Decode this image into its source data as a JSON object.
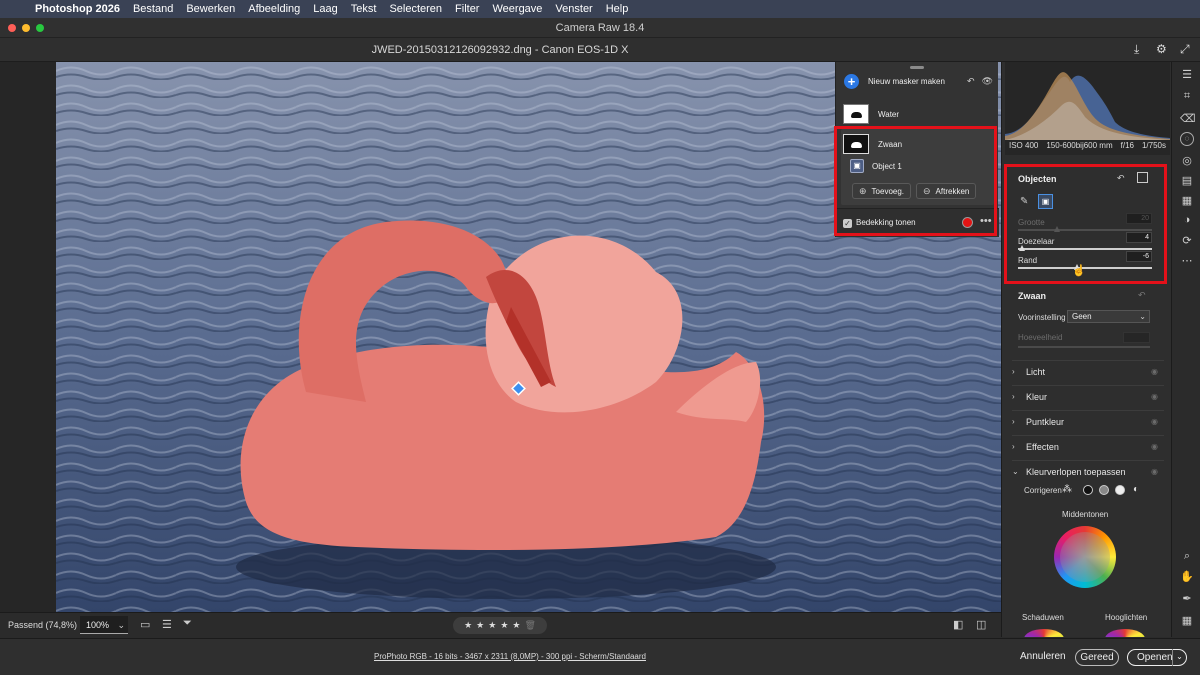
{
  "menubar": {
    "app": "Photoshop 2026",
    "items": [
      "Bestand",
      "Bewerken",
      "Afbeelding",
      "Laag",
      "Tekst",
      "Selecteren",
      "Filter",
      "Weergave",
      "Venster",
      "Help"
    ]
  },
  "window": {
    "title": "Camera Raw 18.4"
  },
  "file": {
    "name": "JWED-20150312126092932.dng",
    "separator": "-",
    "camera": "Canon EOS-1D X"
  },
  "masks": {
    "new_mask_label": "Nieuw masker maken",
    "items": [
      {
        "label": "Water"
      },
      {
        "label": "Zwaan"
      }
    ],
    "sub_item": "Object 1",
    "add_label": "Toevoeg.",
    "subtract_label": "Aftrekken",
    "overlay_label": "Bedekking tonen",
    "overlay_color": "#e31414"
  },
  "histogram": {
    "iso": "ISO 400",
    "focal": "150-600bij600 mm",
    "aperture": "f/16",
    "shutter": "1/750s"
  },
  "objects_panel": {
    "title": "Objecten",
    "grootte": {
      "label": "Grootte",
      "value": "20"
    },
    "doezelaar": {
      "label": "Doezelaar",
      "value": "4"
    },
    "rand": {
      "label": "Rand",
      "value": "-6"
    }
  },
  "zwaan_panel": {
    "title": "Zwaan",
    "preset_label": "Voorinstelling",
    "preset_value": "Geen",
    "amount_label": "Hoeveelheid"
  },
  "sections": [
    "Licht",
    "Kleur",
    "Puntkleur",
    "Effecten",
    "Kleurverlopen toepassen"
  ],
  "color_grading": {
    "adjust_label": "Corrigeren",
    "midtones": "Middentonen",
    "shadows": "Schaduwen",
    "highlights": "Hooglichten"
  },
  "bottom": {
    "fit_label": "Passend (74,8%)",
    "zoom_value": "100%",
    "stars": [
      "★",
      "★",
      "★",
      "★",
      "★"
    ],
    "file_info": "ProPhoto RGB - 16 bits - 3467 x 2311 (8,0MP) - 300 ppi - Scherm/Standaard"
  },
  "buttons": {
    "cancel": "Annuleren",
    "done": "Gereed",
    "open": "Openen"
  }
}
